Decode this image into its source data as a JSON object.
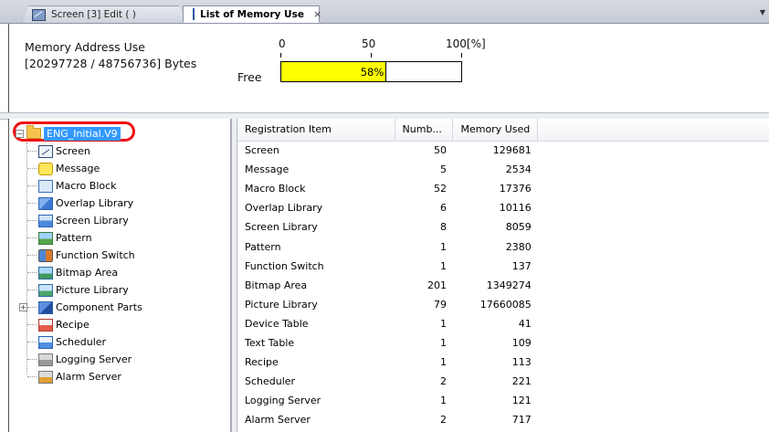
{
  "tabs": [
    {
      "label": "Screen [3] Edit (          )",
      "icon": "screen-edit-icon",
      "active": false
    },
    {
      "label": "List of Memory Use",
      "icon": "memory-list-icon",
      "active": true,
      "close": "×"
    }
  ],
  "summary": {
    "title": "Memory Address Use",
    "bytes": "[20297728 / 48756736] Bytes",
    "scale": [
      "0",
      "50",
      "100[%]"
    ],
    "free_label": "Free",
    "free_percent_text": "58%",
    "free_fraction": 0.58,
    "bar_color": "#ffff00"
  },
  "tree": {
    "root": {
      "label": "ENG_Initial.V9",
      "expander": "−",
      "highlight_color": "#e11111",
      "selected_color": "#3399ff"
    },
    "items": [
      {
        "label": "Screen",
        "icon": "screen-icon",
        "cls": "ti-screen"
      },
      {
        "label": "Message",
        "icon": "message-icon",
        "cls": "ti-message"
      },
      {
        "label": "Macro Block",
        "icon": "macro-block-icon",
        "cls": "ti-macro"
      },
      {
        "label": "Overlap Library",
        "icon": "overlap-library-icon",
        "cls": "ti-overlap"
      },
      {
        "label": "Screen Library",
        "icon": "screen-library-icon",
        "cls": "ti-screenlib"
      },
      {
        "label": "Pattern",
        "icon": "pattern-icon",
        "cls": "ti-pattern"
      },
      {
        "label": "Function Switch",
        "icon": "function-switch-icon",
        "cls": "ti-fswitch"
      },
      {
        "label": "Bitmap Area",
        "icon": "bitmap-area-icon",
        "cls": "ti-bitmap"
      },
      {
        "label": "Picture Library",
        "icon": "picture-library-icon",
        "cls": "ti-picture"
      },
      {
        "label": "Component Parts",
        "icon": "component-parts-icon",
        "cls": "ti-component",
        "expander": "+"
      },
      {
        "label": "Recipe",
        "icon": "recipe-icon",
        "cls": "ti-recipe"
      },
      {
        "label": "Scheduler",
        "icon": "scheduler-icon",
        "cls": "ti-scheduler"
      },
      {
        "label": "Logging Server",
        "icon": "logging-server-icon",
        "cls": "ti-logging"
      },
      {
        "label": "Alarm Server",
        "icon": "alarm-server-icon",
        "cls": "ti-alarm"
      }
    ]
  },
  "table": {
    "columns": [
      "Registration Item",
      "Numb...",
      "Memory Used"
    ],
    "rows": [
      [
        "Screen",
        "50",
        "129681"
      ],
      [
        "Message",
        "5",
        "2534"
      ],
      [
        "Macro Block",
        "52",
        "17376"
      ],
      [
        "Overlap Library",
        "6",
        "10116"
      ],
      [
        "Screen Library",
        "8",
        "8059"
      ],
      [
        "Pattern",
        "1",
        "2380"
      ],
      [
        "Function Switch",
        "1",
        "137"
      ],
      [
        "Bitmap Area",
        "201",
        "1349274"
      ],
      [
        "Picture Library",
        "79",
        "17660085"
      ],
      [
        "Device Table",
        "1",
        "41"
      ],
      [
        "Text Table",
        "1",
        "109"
      ],
      [
        "Recipe",
        "1",
        "113"
      ],
      [
        "Scheduler",
        "2",
        "221"
      ],
      [
        "Logging Server",
        "1",
        "121"
      ],
      [
        "Alarm Server",
        "2",
        "717"
      ]
    ]
  }
}
